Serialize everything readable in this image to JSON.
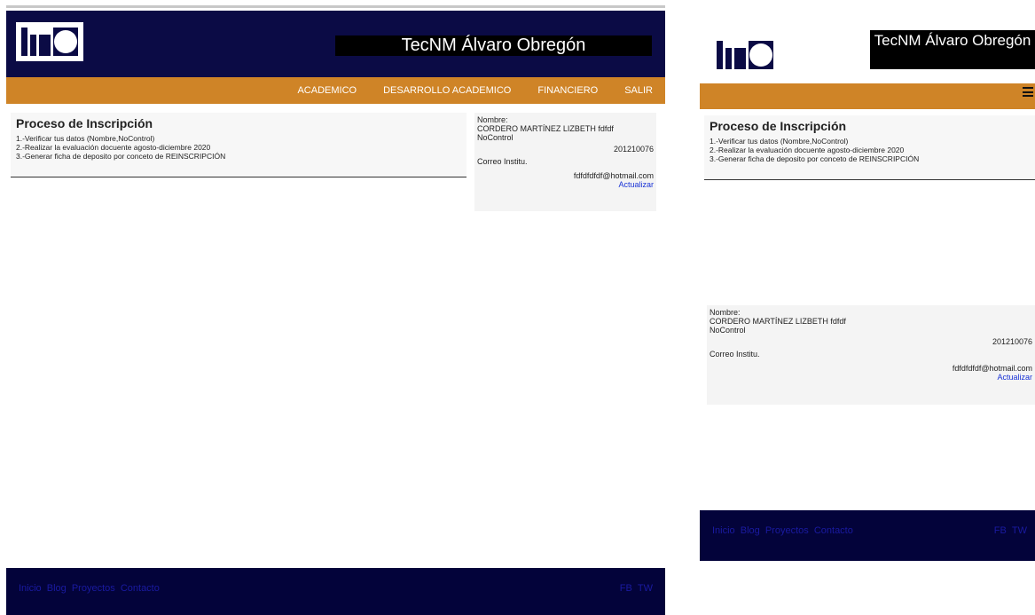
{
  "site": {
    "title": "TecNM Álvaro Obregón",
    "title_mobile": "TecNM Álvaro Obregón"
  },
  "nav": {
    "items": [
      "ACADEMICO",
      "DESARROLLO ACADEMICO",
      "FINANCIERO",
      "SALIR"
    ]
  },
  "process": {
    "heading": "Proceso de Inscripción",
    "steps": [
      "1.-Verificar tus datos (Nombre,NoControl)",
      "2.-Realizar la evaluación docuente agosto-diciembre 2020",
      "3.-Generar ficha de deposito por conceto de REINSCRIPCIÓN"
    ]
  },
  "student": {
    "name_label": "Nombre:",
    "name": "CORDERO MARTÍNEZ LIZBETH fdfdf",
    "control_label": "NoControl",
    "control": "201210076",
    "email_label": "Correo Institu.",
    "email": "fdfdfdfdf@hotmail.com",
    "update_link": "Actualizar"
  },
  "footer": {
    "links": [
      "Inicio",
      "Blog",
      "Proyectos",
      "Contacto"
    ],
    "social": [
      "FB",
      "TW"
    ]
  },
  "icons": {
    "menu": "hamburger-menu-icon",
    "logo": "itao-logo"
  },
  "colors": {
    "header": "#0b0b45",
    "nav": "#cf8427",
    "footer": "#03033a",
    "link": "#1a33d6"
  }
}
